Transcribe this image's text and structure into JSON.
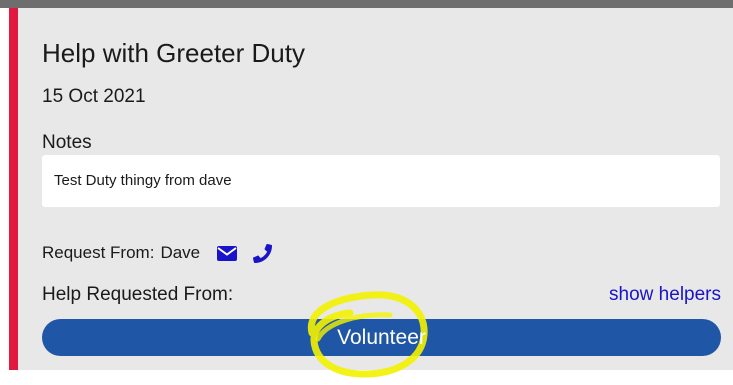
{
  "card": {
    "title": "Help with Greeter Duty",
    "date": "15 Oct 2021",
    "notes_label": "Notes",
    "notes_text": "Test Duty thingy from dave",
    "request_from_label": "Request From:",
    "request_from_name": "Dave",
    "icons": {
      "mail": "envelope-icon",
      "phone": "phone-icon"
    },
    "help_requested_label": "Help Requested From:",
    "show_helpers_label": "show helpers",
    "volunteer_label": "Volunteer"
  },
  "colors": {
    "accent": "#e2183f",
    "card_bg": "#e8e8e8",
    "button": "#1f56a6",
    "link": "#1a14c8",
    "icon": "#1a14c8",
    "highlight": "#f2f200"
  }
}
